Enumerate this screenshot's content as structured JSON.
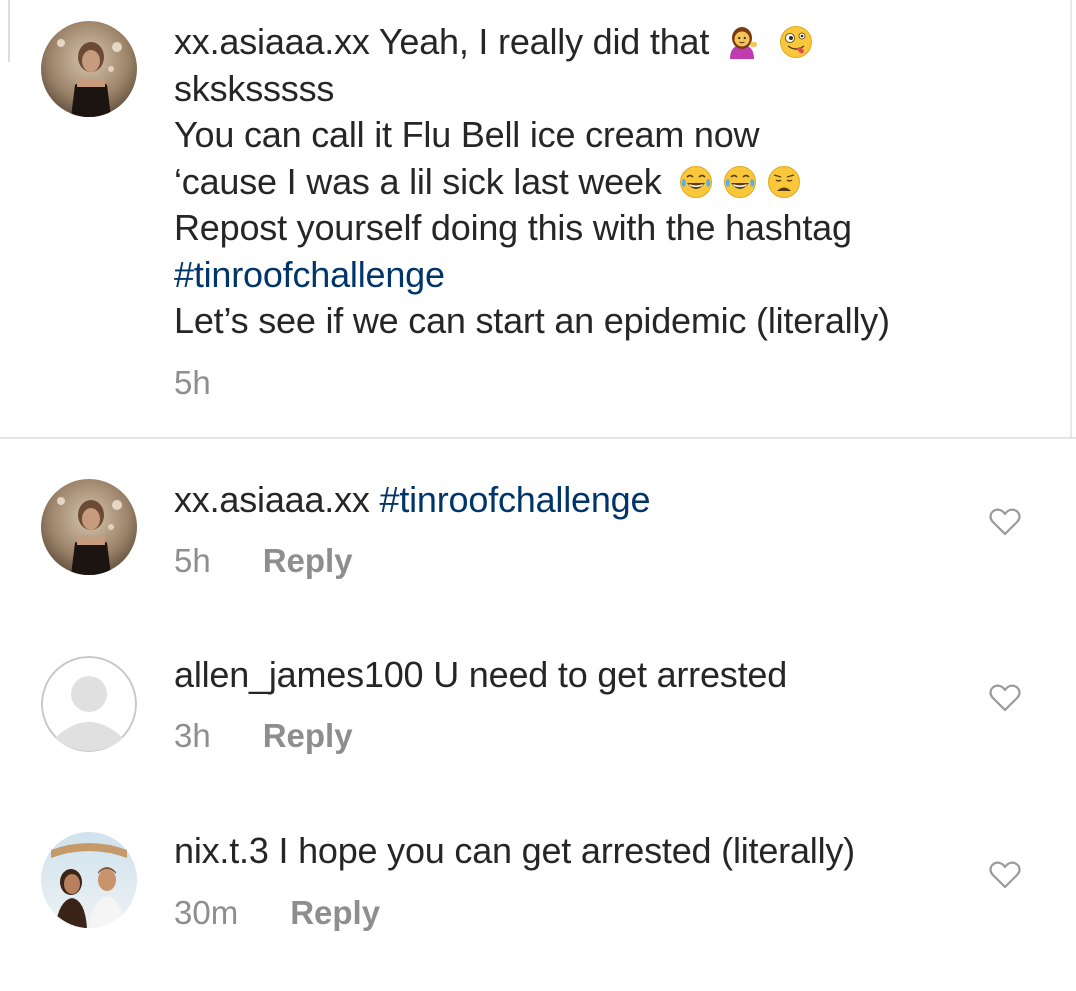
{
  "caption": {
    "username": "xx.asiaaa.xx",
    "line1_text": "Yeah, I really did that",
    "line1_emojis": [
      "woman-tipping-hand-emoji",
      "zany-face-emoji"
    ],
    "line2": "sksksssss",
    "line3": "You can call it Flu Bell ice cream now",
    "line4_text": "‘cause I was a lil sick last week",
    "line4_emojis": [
      "tears-of-joy-emoji",
      "tears-of-joy-emoji",
      "weary-face-emoji"
    ],
    "line5": "Repost yourself doing this with the hashtag",
    "hashtag": "#tinroofchallenge",
    "line7": "Let’s see if we can start an epidemic (literally)",
    "time": "5h"
  },
  "comments": [
    {
      "username": "xx.asiaaa.xx",
      "text": "",
      "hashtag": "#tinroofchallenge",
      "time": "5h",
      "reply_label": "Reply",
      "avatar": "user-photo-avatar"
    },
    {
      "username": "allen_james100",
      "text": "U need to get arrested",
      "time": "3h",
      "reply_label": "Reply",
      "avatar": "default-avatar"
    },
    {
      "username": "nix.t.3",
      "text": "I hope you can get arrested (literally)",
      "time": "30m",
      "reply_label": "Reply",
      "avatar": "couple-photo-avatar"
    }
  ],
  "colors": {
    "text": "#262626",
    "hashtag": "#003569",
    "meta": "#8e8e8e",
    "divider": "#e4e4e4"
  }
}
